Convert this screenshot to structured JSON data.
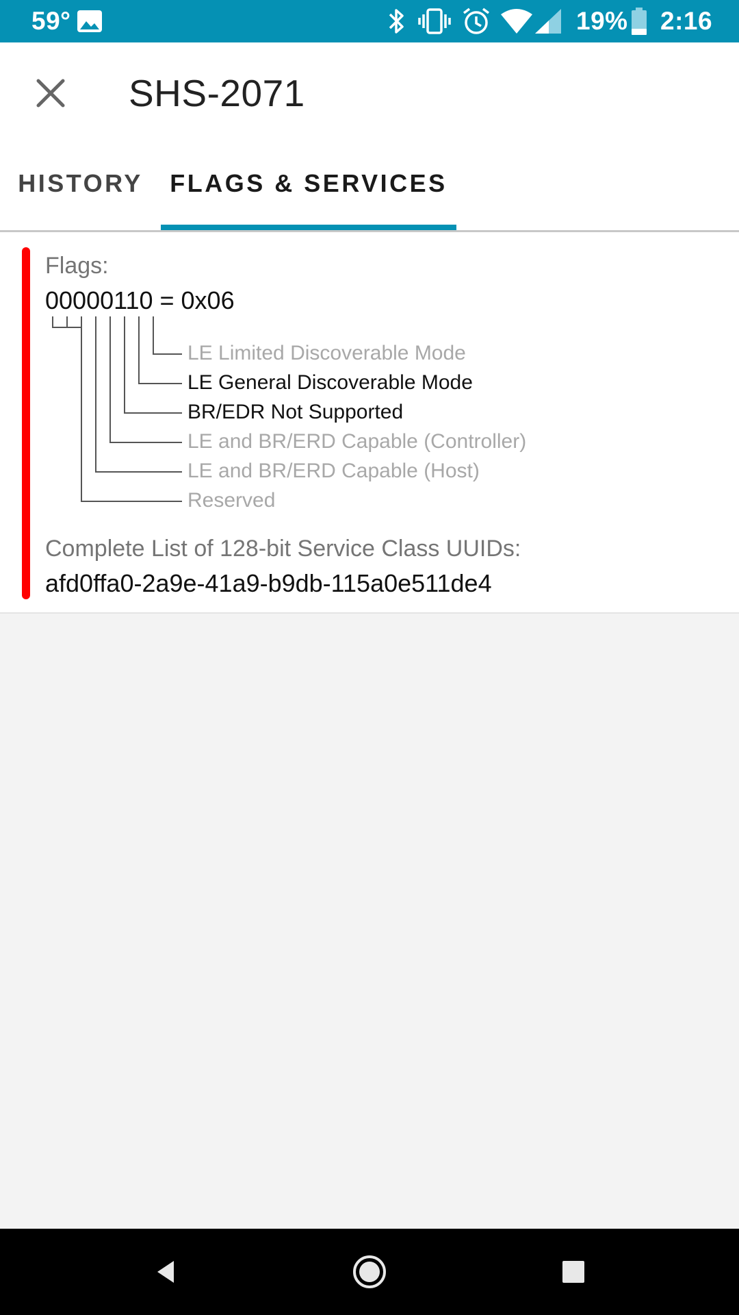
{
  "status_bar": {
    "temperature": "59°",
    "battery": "19%",
    "time": "2:16",
    "icons": [
      "image-icon",
      "bluetooth-icon",
      "vibrate-icon",
      "alarm-icon",
      "wifi-icon",
      "signal-icon",
      "battery-icon"
    ]
  },
  "app_bar": {
    "title": "SHS-2071",
    "close_icon": "close-icon"
  },
  "tabs": [
    {
      "label": "HISTORY",
      "selected": false
    },
    {
      "label": "FLAGS & SERVICES",
      "selected": true
    }
  ],
  "flags_section": {
    "label": "Flags:",
    "value": "00000110 = 0x06",
    "flags": [
      {
        "label": "LE Limited Discoverable Mode",
        "active": false
      },
      {
        "label": "LE General Discoverable Mode",
        "active": true
      },
      {
        "label": "BR/EDR Not Supported",
        "active": true
      },
      {
        "label": "LE and BR/ERD Capable (Controller)",
        "active": false
      },
      {
        "label": "LE and BR/ERD Capable (Host)",
        "active": false
      },
      {
        "label": "Reserved",
        "active": false
      }
    ]
  },
  "services_section": {
    "label": "Complete List of 128-bit Service Class UUIDs:",
    "value": "afd0ffa0-2a9e-41a9-b9db-115a0e511de4"
  },
  "colors": {
    "status_bar": "#0591b4",
    "tab_indicator": "#0591b4",
    "accent_bar": "#ff0000"
  },
  "nav_bar": {
    "icons": [
      "back-icon",
      "home-icon",
      "recents-icon"
    ]
  }
}
